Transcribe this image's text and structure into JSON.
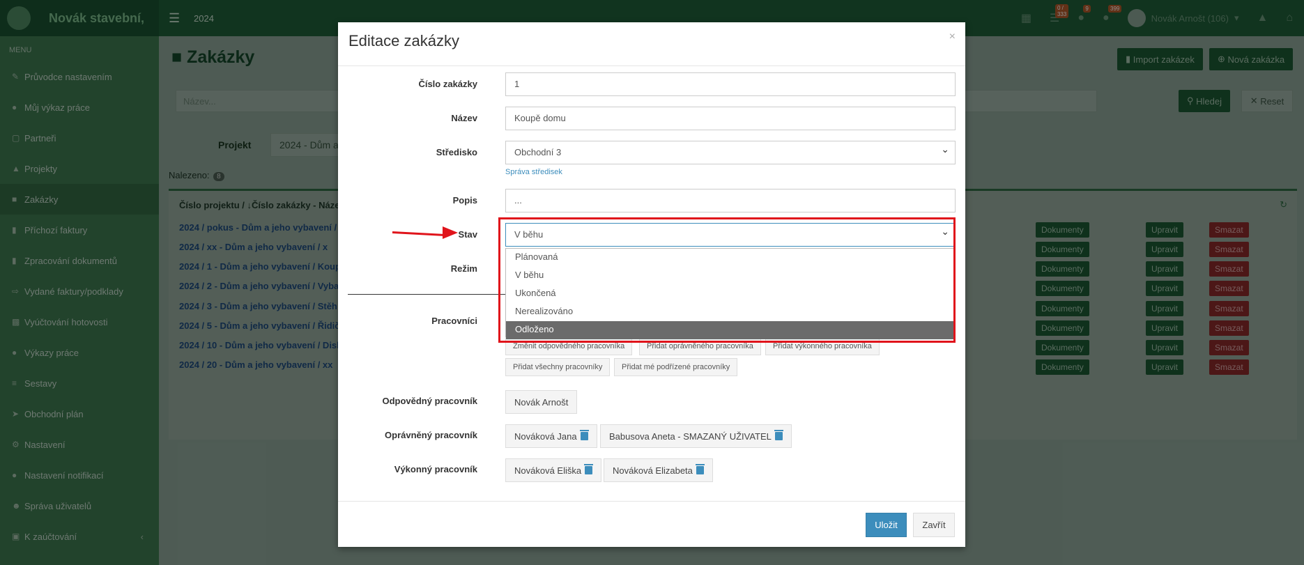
{
  "app": {
    "brand": "Novák stavební,",
    "year": "2024"
  },
  "topbar": {
    "badges": [
      "0 / 333",
      "9",
      "399"
    ],
    "user": "Novák Arnošt (106)"
  },
  "sidebar": {
    "header": "MENU",
    "items": [
      {
        "label": "Průvodce nastavením",
        "icon": "wand-icon"
      },
      {
        "label": "Můj výkaz práce",
        "icon": "clock-icon"
      },
      {
        "label": "Partneři",
        "icon": "building-icon"
      },
      {
        "label": "Projekty",
        "icon": "cubes-icon"
      },
      {
        "label": "Zakázky",
        "icon": "cube-icon"
      },
      {
        "label": "Příchozí faktury",
        "icon": "file-icon"
      },
      {
        "label": "Zpracování dokumentů",
        "icon": "file-icon"
      },
      {
        "label": "Vydané faktury/podklady",
        "icon": "export-icon"
      },
      {
        "label": "Vyúčtování hotovosti",
        "icon": "money-icon"
      },
      {
        "label": "Výkazy práce",
        "icon": "clock-icon"
      },
      {
        "label": "Sestavy",
        "icon": "list-icon"
      },
      {
        "label": "Obchodní plán",
        "icon": "rocket-icon"
      },
      {
        "label": "Nastavení",
        "icon": "gears-icon"
      },
      {
        "label": "Nastavení notifikací",
        "icon": "bell-icon"
      },
      {
        "label": "Správa uživatelů",
        "icon": "users-icon"
      },
      {
        "label": "K zaúčtování",
        "icon": "folder-icon"
      }
    ]
  },
  "main": {
    "title": "Zakázky",
    "import_label": "Import zakázek",
    "new_label": "Nová zakázka",
    "filter_placeholder": "Název...",
    "search_label": "Hledej",
    "reset_label": "Reset",
    "project_label": "Projekt",
    "project_value": "2024 - Dům a",
    "found_label": "Nalezeno:",
    "found_count": "8",
    "table_header": "Číslo projektu / ↓Číslo zakázky - Náze",
    "rows": [
      "2024 / pokus - Dům a jeho vybavení /",
      "2024 / xx - Dům a jeho vybavení / x",
      "2024 / 1 - Dům a jeho vybavení / Koup",
      "2024 / 2 - Dům a jeho vybavení / Vyba",
      "2024 / 3 - Dům a jeho vybavení / Stěh",
      "2024 / 5 - Dům a jeho vybavení / Řidič",
      "2024 / 10 - Dům a jeho vybavení / Disk",
      "2024 / 20 - Dům a jeho vybavení / xx"
    ],
    "row_actions": {
      "docs": "Dokumenty",
      "edit": "Upravit",
      "delete": "Smazat"
    }
  },
  "modal": {
    "title": "Editace zakázky",
    "close_symbol": "×",
    "fields": {
      "cislo_label": "Číslo zakázky",
      "cislo_value": "1",
      "nazev_label": "Název",
      "nazev_value": "Koupě domu",
      "stredisko_label": "Středisko",
      "stredisko_value": "Obchodní 3",
      "stredisko_link": "Správa středisek",
      "popis_label": "Popis",
      "popis_placeholder": "...",
      "stav_label": "Stav",
      "stav_value": "V běhu",
      "rezim_label": "Režim",
      "pracovnici_label": "Pracovníci"
    },
    "stav_options": [
      "Plánovaná",
      "V běhu",
      "Ukončená",
      "Nerealizováno",
      "Odloženo"
    ],
    "stav_highlighted": "Odloženo",
    "worker_buttons_row1": [
      "Změnit odpovědného pracovníka",
      "Přidat oprávněného pracovníka",
      "Přidat výkonného pracovníka"
    ],
    "worker_buttons_row2": [
      "Přidat všechny pracovníky",
      "Přidat mé podřízené pracovníky"
    ],
    "odpovedny_label": "Odpovědný pracovník",
    "odpovedny": [
      "Novák Arnošt"
    ],
    "opravneny_label": "Oprávněný pracovník",
    "opravneny": [
      "Nováková Jana",
      "Babusova Aneta - SMAZANÝ UŽIVATEL"
    ],
    "vykonny_label": "Výkonný pracovník",
    "vykonny": [
      "Nováková Eliška",
      "Nováková Elizabeta"
    ],
    "save_label": "Uložit",
    "close_label": "Zavřít"
  },
  "colors": {
    "annotation": "#e0141b",
    "primary": "#3c8dbc",
    "brand": "#1f5f3a"
  }
}
